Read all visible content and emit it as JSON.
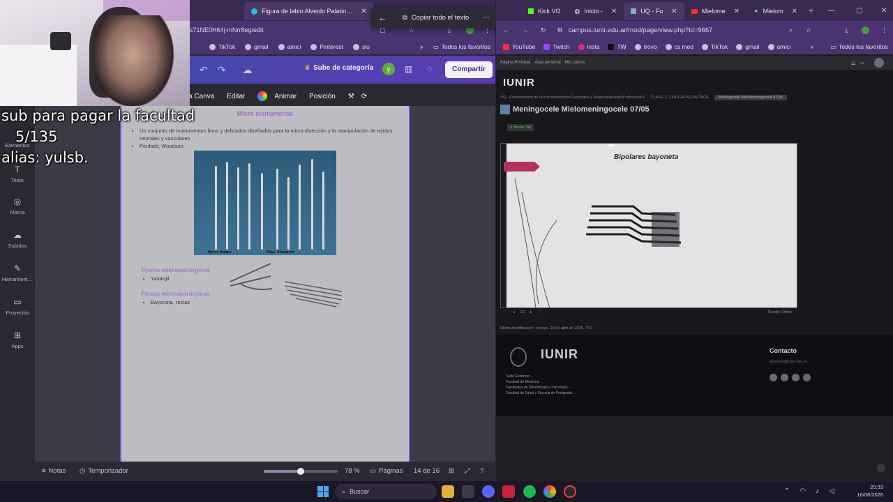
{
  "left_browser": {
    "tabs": [
      {
        "label": "Figura de labio Alveolo Palatin…",
        "active": true
      }
    ],
    "url": "s71NE0H64j-mNrr8eg/edit",
    "bookmarks": [
      "TikTok",
      "gmail",
      "amici",
      "Pinterest",
      "siu"
    ],
    "bookmarks_folder": "Todos los favoritos"
  },
  "copy_popup": {
    "label": "Copiar todo el texto"
  },
  "canva": {
    "upgrade_label": "Sube de categoría",
    "avatar_initial": "y",
    "share_label": "Compartir",
    "tools": {
      "canva_label": "a Canva",
      "edit": "Editar",
      "animate": "Animar",
      "position": "Posición"
    },
    "rail": [
      {
        "label": "Elementos",
        "icon": "shapes-icon"
      },
      {
        "label": "Texto",
        "icon": "text-icon"
      },
      {
        "label": "Marca",
        "icon": "brand-icon"
      },
      {
        "label": "Subidos",
        "icon": "cloud-upload-icon"
      },
      {
        "label": "Herramient…",
        "icon": "tools-icon"
      },
      {
        "label": "Proyectos",
        "icon": "folder-icon"
      },
      {
        "label": "Apps",
        "icon": "apps-icon"
      }
    ],
    "page": {
      "title": "Micro instrumental",
      "bullets": [
        "Un conjunto de instrumentos finos y delicados diseñados para la micro disección y la manipulación de tejidos neurales y vasculares",
        "Penfield, Woodson"
      ],
      "photo_labels": {
        "nerve": "Nerve Hooks",
        "misc": "Misc. Elevators"
      },
      "scissors_heading": "Tijeras microquirúrgicas",
      "scissors_item": "Yasargil",
      "forceps_heading": "Pinzas microquirúrgicas",
      "forceps_item": "Bayoneta, rectas"
    },
    "bottom": {
      "notes": "Notas",
      "timer": "Temporizador",
      "zoom": "78 %",
      "zoom_fraction": 0.5,
      "pages_label": "Páginas",
      "page_count": "14 de 16"
    }
  },
  "overlay": {
    "line1": "sub para pagar la facultad",
    "line2": "5/135",
    "line3": "alias: yulsb."
  },
  "right_browser": {
    "tabs": [
      {
        "label": "Kick VO",
        "active": false
      },
      {
        "label": "Inicio - ",
        "active": false
      },
      {
        "label": "UQ - Fu",
        "active": true
      },
      {
        "label": "Mielome",
        "active": false
      },
      {
        "label": "Mielom",
        "active": false
      }
    ],
    "url": "campus.iunir.edu.ar/mod/page/view.php?id=9667",
    "bookmarks": [
      "YouTube",
      "Twitch",
      "insta",
      "TW",
      "trovo",
      "cs med",
      "TikTok",
      "gmail",
      "amici"
    ],
    "bookmarks_folder": "Todos los favoritos"
  },
  "campus": {
    "nav": [
      "Página Principal",
      "Área personal",
      "Mis cursos"
    ],
    "logo": "IUNIR",
    "crumbs": [
      "UQ - Fundamentos de la Instrumentación Quirúrgica y Responsabilidad Profesional II",
      "CLASE 3. CIRUGÍA PEDIÁTRICA"
    ],
    "crumb_current": "Meningocele Mielomeningocele 07/05",
    "page_title": "Meningocele Mielomeningocele 07/05",
    "done_pill": "✔ Hecho: Ver",
    "slide_title": "Bipolares bayoneta",
    "slide_page": "13",
    "slide_provider": "Google Slides",
    "modified": "Última modificación: viernes, 18 de abril de 2025, 7:53",
    "footer_logo": "IUNIR",
    "footer_lines": [
      "Sede Gobierno: …",
      "Facultad de Medicina",
      "Facultades de Odontología y Psicología: …",
      "Facultad de Salud y Escuela de Postgrado: …"
    ],
    "contact_heading": "Contacto",
    "contact_email": "alumnos@iunir.edu.ar"
  },
  "taskbar": {
    "search_label": "Buscar",
    "time": "20:33",
    "date": "16/08/2026"
  }
}
